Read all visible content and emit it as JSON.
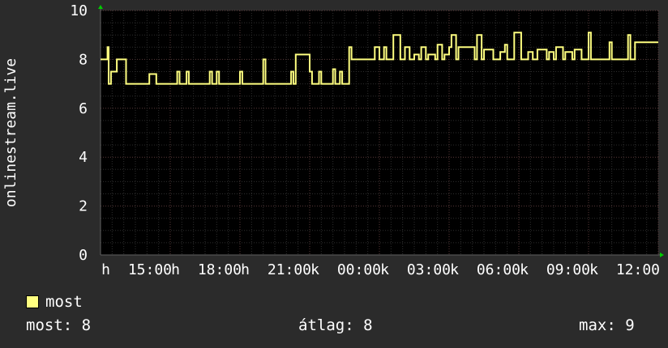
{
  "chart_data": {
    "type": "line",
    "ylabel": "onlinestream.live",
    "ylim": [
      0,
      10
    ],
    "yticks": [
      0,
      2,
      4,
      6,
      8,
      10
    ],
    "xtick_labels": [
      "h",
      "15:00",
      "h",
      "18:00",
      "h",
      "21:00",
      "k",
      "00:00",
      "k",
      "03:00",
      "k",
      "06:00",
      "k",
      "09:00",
      "k",
      "12:00"
    ],
    "grid": true,
    "series": [
      {
        "name": "most",
        "color": "#ffff80",
        "x_hours": [
          0,
          0.3,
          0.3,
          0.35,
          0.35,
          0.45,
          0.45,
          0.7,
          0.7,
          1.0,
          1.0,
          1.1,
          1.1,
          2.1,
          2.1,
          2.4,
          2.4,
          2.5,
          2.5,
          3.3,
          3.3,
          3.4,
          3.4,
          3.7,
          3.7,
          3.8,
          3.8,
          4.7,
          4.7,
          4.8,
          4.8,
          5.0,
          5.0,
          5.1,
          5.1,
          6.0,
          6.0,
          6.1,
          6.1,
          7.0,
          7.0,
          7.1,
          7.1,
          8.2,
          8.2,
          8.3,
          8.3,
          8.4,
          8.4,
          9.0,
          9.0,
          9.1,
          9.1,
          9.4,
          9.4,
          9.5,
          9.5,
          10.0,
          10.0,
          10.1,
          10.1,
          10.3,
          10.3,
          10.4,
          10.4,
          10.7,
          10.7,
          10.8,
          10.8,
          11.7,
          11.7,
          11.8,
          11.8,
          12.0,
          12.0,
          12.2,
          12.2,
          12.3,
          12.3,
          12.6,
          12.6,
          12.9,
          12.9,
          13.1,
          13.1,
          13.3,
          13.3,
          13.5,
          13.5,
          13.7,
          13.7,
          13.8,
          13.8,
          14.0,
          14.0,
          14.1,
          14.1,
          14.4,
          14.4,
          14.5,
          14.5,
          14.7,
          14.7,
          14.8,
          14.8,
          15.0,
          15.0,
          15.1,
          15.1,
          15.3,
          15.3,
          15.4,
          15.4,
          16.1,
          16.1,
          16.2,
          16.2,
          16.4,
          16.4,
          16.5,
          16.5,
          16.9,
          16.9,
          17.2,
          17.2,
          17.4,
          17.4,
          17.5,
          17.5,
          17.8,
          17.8,
          18.1,
          18.1,
          18.4,
          18.4,
          18.6,
          18.6,
          18.8,
          18.8,
          19.2,
          19.2,
          19.3,
          19.3,
          19.5,
          19.5,
          19.6,
          19.6,
          19.9,
          19.9,
          20.0,
          20.0,
          20.3,
          20.3,
          20.4,
          20.4,
          20.7,
          20.7,
          21.0,
          21.0,
          21.1,
          21.1,
          21.9,
          21.9,
          22.0,
          22.0,
          22.7,
          22.7,
          22.8,
          22.8,
          23.0,
          23.0,
          24.0
        ],
        "values": [
          8,
          8,
          8.5,
          8.5,
          7,
          7,
          7.5,
          7.5,
          8,
          8,
          8,
          8,
          7,
          7,
          7.4,
          7.4,
          7,
          7,
          7,
          7,
          7.5,
          7.5,
          7,
          7,
          7.5,
          7.5,
          7,
          7,
          7.5,
          7.5,
          7,
          7,
          7.5,
          7.5,
          7,
          7,
          7.5,
          7.5,
          7,
          7,
          8,
          8,
          7,
          7,
          7.5,
          7.5,
          7,
          7,
          8.2,
          8.2,
          7.5,
          7.5,
          7,
          7,
          7.5,
          7.5,
          7,
          7,
          7.6,
          7.6,
          7,
          7,
          7.5,
          7.5,
          7,
          7,
          8.5,
          8.5,
          8,
          8,
          8,
          8,
          8.5,
          8.5,
          8,
          8,
          8.5,
          8.5,
          8,
          8,
          9,
          9,
          8,
          8,
          8.5,
          8.5,
          8,
          8,
          8.2,
          8.2,
          8,
          8,
          8.5,
          8.5,
          8,
          8,
          8.2,
          8.2,
          8,
          8,
          8.6,
          8.6,
          8,
          8,
          8.2,
          8.2,
          8.5,
          8.5,
          9,
          9,
          8,
          8,
          8.5,
          8.5,
          8,
          8,
          9,
          9,
          8,
          8,
          8.4,
          8.4,
          8,
          8,
          8.3,
          8.3,
          8.6,
          8.6,
          8,
          8,
          9.1,
          9.1,
          8,
          8,
          8.3,
          8.3,
          8,
          8,
          8.4,
          8.4,
          8,
          8,
          8.3,
          8.3,
          8,
          8,
          8.5,
          8.5,
          8,
          8,
          8.3,
          8.3,
          8,
          8,
          8.4,
          8.4,
          8,
          8,
          9.1,
          9.1,
          8,
          8,
          8.7,
          8.7,
          8,
          8,
          9,
          9,
          8,
          8,
          8.7,
          8.7,
          8,
          8,
          8.6,
          8.6,
          8,
          8,
          8
        ]
      }
    ]
  },
  "legend": {
    "label": "most",
    "color": "#ffff80"
  },
  "stats": {
    "most": "most: 8",
    "avg": "átlag: 8",
    "max": "max: 9"
  }
}
